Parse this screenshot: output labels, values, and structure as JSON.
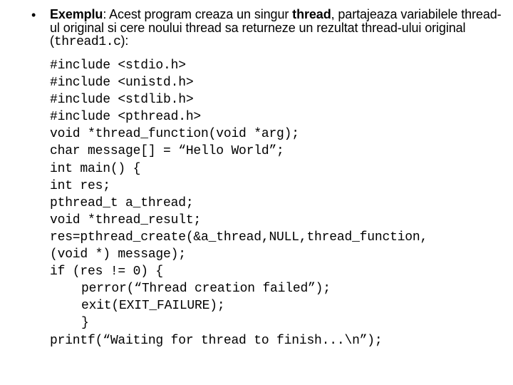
{
  "slide": {
    "bullet_glyph": "•",
    "intro": {
      "label": "Exemplu",
      "after_label": ": Acest program creaza un singur ",
      "emph": "thread",
      "after_emph": ", partajeaza variabilele thread-ul original si cere noului thread sa returneze un rezultat thread-ului original (",
      "filename": "thread1.c",
      "closing": "):"
    },
    "code_lines": [
      {
        "text": "#include <stdio.h>",
        "indent": false
      },
      {
        "text": "#include <unistd.h>",
        "indent": false
      },
      {
        "text": "#include <stdlib.h>",
        "indent": false
      },
      {
        "text": "#include <pthread.h>",
        "indent": false
      },
      {
        "text": "void *thread_function(void *arg);",
        "indent": false
      },
      {
        "text": "char message[] = “Hello World”;",
        "indent": false
      },
      {
        "text": "int main() {",
        "indent": false
      },
      {
        "text": "int res;",
        "indent": false
      },
      {
        "text": "pthread_t a_thread;",
        "indent": false
      },
      {
        "text": "void *thread_result;",
        "indent": false
      },
      {
        "text": "res=pthread_create(&a_thread,NULL,thread_function,",
        "indent": false
      },
      {
        "text": "(void *) message);",
        "indent": false
      },
      {
        "text": "if (res != 0) {",
        "indent": false
      },
      {
        "text": "perror(“Thread creation failed”);",
        "indent": true
      },
      {
        "text": "exit(EXIT_FAILURE);",
        "indent": true
      },
      {
        "text": "}",
        "indent": true
      },
      {
        "text": "printf(“Waiting for thread to finish...\\n”);",
        "indent": false
      }
    ]
  }
}
